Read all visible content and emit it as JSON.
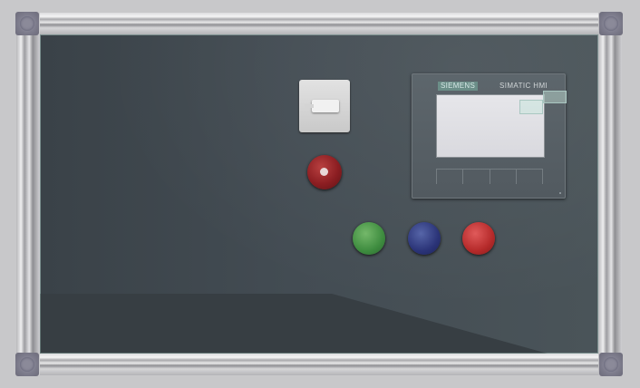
{
  "hmi": {
    "brand": "SIEMENS",
    "model": "SIMATIC HMI"
  },
  "controls": {
    "main_switch": "main-switch",
    "emergency_stop": "emergency-stop",
    "buttons": [
      "green",
      "blue",
      "red"
    ]
  },
  "colors": {
    "panel": "#434c53",
    "frame": "#c8c8ca",
    "green_button": "#3e8c3f",
    "blue_button": "#2b3478",
    "red_button": "#b52a2a",
    "estop": "#8c1e22"
  }
}
